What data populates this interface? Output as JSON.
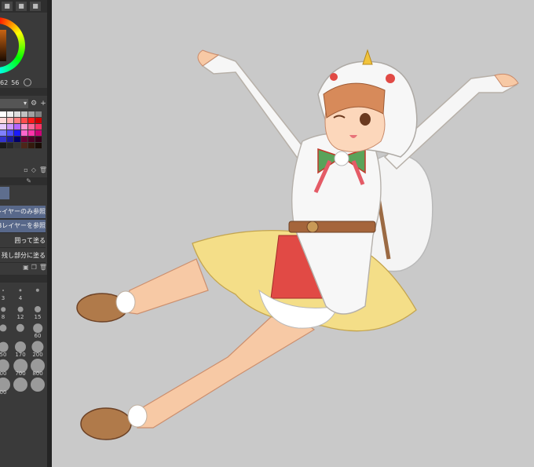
{
  "colors": {
    "panel_bg": "#3a3a3a",
    "canvas_bg": "#c9c9c9",
    "selected_row": "#58688a"
  },
  "color_wheel": {
    "values": [
      "62",
      "56"
    ]
  },
  "palette_swatches": [
    "#ffffff",
    "#f0f0f0",
    "#dddddd",
    "#c0c0c0",
    "#a0a0a0",
    "#808080",
    "#ffd9d9",
    "#ffb3b3",
    "#ff8080",
    "#ff4d4d",
    "#ff1a1a",
    "#cc0000",
    "#e6ccff",
    "#cc99ff",
    "#b366ff",
    "#ff99cc",
    "#ff6699",
    "#ff3366",
    "#8080ff",
    "#4d4dff",
    "#1a1aff",
    "#ff66cc",
    "#ff33aa",
    "#cc0077",
    "#3333cc",
    "#1a1a99",
    "#000066",
    "#660033",
    "#4d0026",
    "#330019",
    "#1a1a1a",
    "#262626",
    "#333333",
    "#4d2619",
    "#331a0d",
    "#1a0d06"
  ],
  "reference_options": [
    {
      "label": "レイヤーのみ参照",
      "selected": true
    },
    {
      "label": "Bレイヤーを参照",
      "selected": true
    },
    {
      "label": "囲って塗る",
      "selected": false
    },
    {
      "label": "残し部分に塗る",
      "selected": false
    }
  ],
  "brush_sizes": [
    {
      "label": "3"
    },
    {
      "label": "4"
    },
    {
      "label": ""
    },
    {
      "label": "8"
    },
    {
      "label": "12"
    },
    {
      "label": "15"
    },
    {
      "label": ""
    },
    {
      "label": ""
    },
    {
      "label": "60"
    },
    {
      "label": "50"
    },
    {
      "label": "170"
    },
    {
      "label": "200"
    },
    {
      "label": "00"
    },
    {
      "label": "700"
    },
    {
      "label": "800"
    },
    {
      "label": "00"
    },
    {
      "label": ""
    },
    {
      "label": ""
    }
  ]
}
